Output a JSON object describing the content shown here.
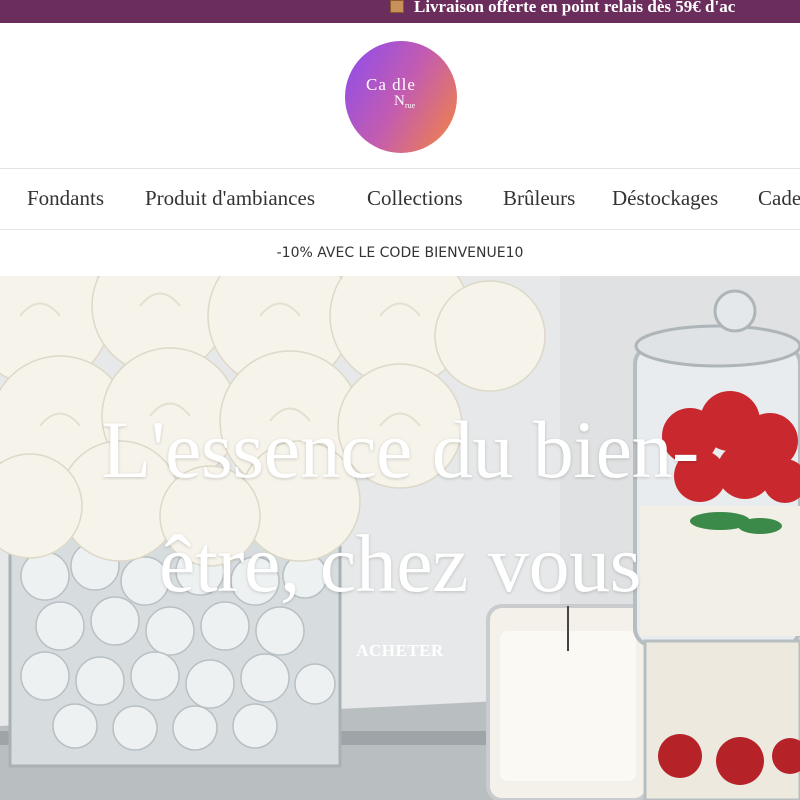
{
  "announcement": {
    "icon": "package-icon",
    "text": "Livraison offerte en point relais dès 59€ d'ac"
  },
  "logo": {
    "line1": "Ca dle",
    "line2": "N",
    "line3": "rue"
  },
  "nav": {
    "items": [
      {
        "label": "Fondants"
      },
      {
        "label": "Produit d'ambiances"
      },
      {
        "label": "Collections"
      },
      {
        "label": "Brûleurs"
      },
      {
        "label": "Déstockages"
      },
      {
        "label": "Cade"
      }
    ]
  },
  "promo": {
    "text": "-10% AVEC LE CODE BIENVENUE10"
  },
  "hero": {
    "title_line1": "L'essence du bien-",
    "title_line2": "être, chez vous",
    "cta_label": "ACHETER"
  },
  "colors": {
    "announcement_bg": "#6b2d5c",
    "logo_gradient_start": "#8b4cf0",
    "logo_gradient_end": "#f4863e"
  }
}
